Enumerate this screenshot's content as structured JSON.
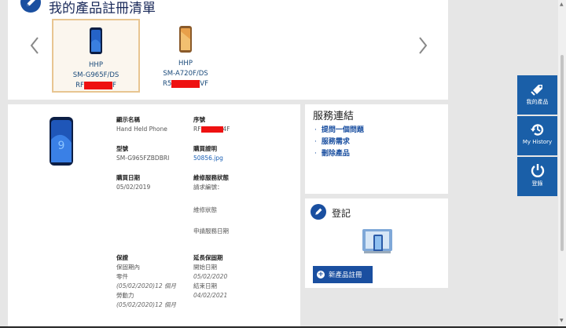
{
  "page": {
    "title": "我的產品註冊清單"
  },
  "products": [
    {
      "line1": "HHP",
      "line2": "SM-G965F/DS",
      "serial_prefix": "RF",
      "serial_suffix": "F"
    },
    {
      "line1": "HHP",
      "line2": "SM-A720F/DS",
      "serial_prefix": "R5",
      "serial_suffix": "VF"
    }
  ],
  "detail": {
    "display_name_label": "顯示名稱",
    "display_name_value": "Hand Held Phone",
    "serial_label": "序號",
    "serial_prefix": "RF",
    "serial_suffix": "4F",
    "model_label": "型號",
    "model_value": "SM-G965FZBDBRI",
    "proof_label": "購買證明",
    "proof_value": "50856.jpg",
    "purchase_date_label": "購買日期",
    "purchase_date_value": "05/02/2019",
    "repair_status_label": "維修服務狀態",
    "request_code_label": "請求編號：",
    "repair_state_label": "維修狀態",
    "service_date_label": "申請服務日期",
    "warranty_label": "保證",
    "in_warranty": "保固期內",
    "parts_label": "零件",
    "parts_value": "(05/02/2020)12 個月",
    "labor_label": "勞動力",
    "labor_value": "(05/02/2020)12 個月",
    "extended_label": "延長保固期",
    "start_label": "開始日期",
    "start_value": "05/02/2020",
    "end_label": "結束日期",
    "end_value": "04/02/2021"
  },
  "service": {
    "title": "服務連結",
    "links": [
      "提問一個問題",
      "服務需求",
      "刪除產品"
    ]
  },
  "register": {
    "title": "登記",
    "new_button": "新產品註冊"
  },
  "sidebar": {
    "my_products": "我的產品",
    "my_history": "My History",
    "logout": "登錄"
  },
  "colors": {
    "brand_blue": "#1a4fa0",
    "sidebar_blue": "#1a5fa8",
    "redaction": "#ee1111",
    "selected_card_border": "#e8c591"
  },
  "icons": [
    "pencil-icon",
    "chevron-left-icon",
    "chevron-right-icon",
    "phone-icon",
    "devices-icon",
    "plus-icon",
    "tag-icon",
    "history-icon",
    "power-icon"
  ]
}
